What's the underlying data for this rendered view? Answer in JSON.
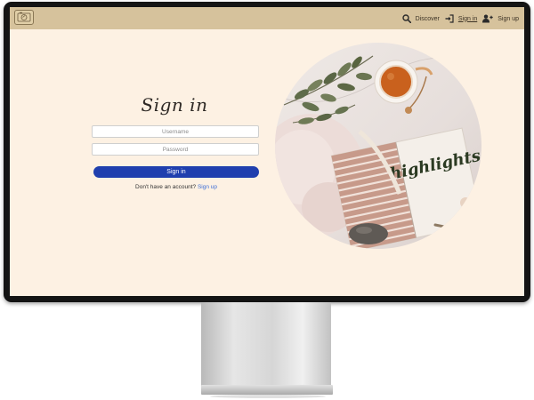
{
  "navbar": {
    "links": [
      {
        "label": "Discover",
        "icon": "search-icon"
      },
      {
        "label": "Sign in",
        "icon": "sign-in-icon"
      },
      {
        "label": "Sign up",
        "icon": "add-user-icon"
      }
    ],
    "logo_icon": "camera-logo-icon"
  },
  "form": {
    "title": "Sign in",
    "username_placeholder": "Username",
    "password_placeholder": "Password",
    "submit_label": "Sign in",
    "signup_prompt": "Don't have an account?",
    "signup_link": "Sign up"
  },
  "image": {
    "book_text": "highlights"
  },
  "colors": {
    "navbar": "#d6c29c",
    "page_background": "#fdf1e3",
    "button": "#1f3fae",
    "link": "#3f6fd6"
  }
}
